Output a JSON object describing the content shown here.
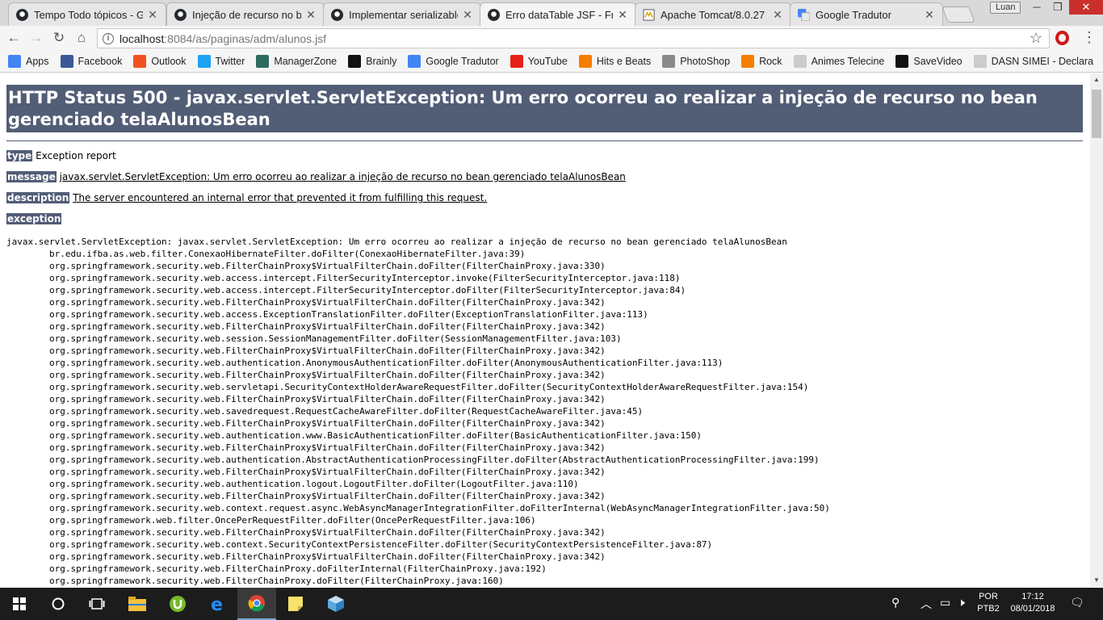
{
  "tabs": [
    {
      "title": "Tempo Todo tópicos - GU",
      "favicon": "github-icon",
      "active": false
    },
    {
      "title": "Injeção de recurso no be",
      "favicon": "github-icon",
      "active": false
    },
    {
      "title": "Implementar serializable",
      "favicon": "github-icon",
      "active": false
    },
    {
      "title": "Erro dataTable JSF - Fron",
      "favicon": "github-icon",
      "active": true
    },
    {
      "title": "Apache Tomcat/8.0.27 -",
      "favicon": "tomcat-icon",
      "active": false
    },
    {
      "title": "Google Tradutor",
      "favicon": "google-translate-icon",
      "active": false
    }
  ],
  "window": {
    "profile_name": "Luan"
  },
  "address": {
    "host": "localhost",
    "rest": ":8084/as/paginas/adm/alunos.jsf"
  },
  "bookmarks": [
    {
      "label": "Apps",
      "icon": "apps-grid-icon",
      "color": "#4285f4"
    },
    {
      "label": "Facebook",
      "icon": "facebook-icon",
      "color": "#3b5998"
    },
    {
      "label": "Outlook",
      "icon": "outlook-icon",
      "color": "#f25022"
    },
    {
      "label": "Twitter",
      "icon": "twitter-icon",
      "color": "#1da1f2"
    },
    {
      "label": "ManagerZone",
      "icon": "managerzone-icon",
      "color": "#2e6b5e"
    },
    {
      "label": "Brainly",
      "icon": "brainly-icon",
      "color": "#111111"
    },
    {
      "label": "Google Tradutor",
      "icon": "google-translate-icon",
      "color": "#4285f4"
    },
    {
      "label": "YouTube",
      "icon": "youtube-icon",
      "color": "#e62117"
    },
    {
      "label": "Hits e Beats",
      "icon": "blogger-icon",
      "color": "#f57d00"
    },
    {
      "label": "PhotoShop",
      "icon": "photoshop-icon",
      "color": "#8a8a8a"
    },
    {
      "label": "Rock",
      "icon": "blogger-icon",
      "color": "#f57d00"
    },
    {
      "label": "Animes Telecine",
      "icon": "page-icon",
      "color": "#cccccc"
    },
    {
      "label": "SaveVideo",
      "icon": "savevideo-icon",
      "color": "#111111"
    },
    {
      "label": "DASN SIMEI - Declara",
      "icon": "page-icon",
      "color": "#cccccc"
    }
  ],
  "error": {
    "title": "HTTP Status 500 - javax.servlet.ServletException: Um erro ocorreu ao realizar a injeção de recurso no bean gerenciado telaAlunosBean",
    "type_label": "type",
    "type_value": "Exception report",
    "message_label": "message",
    "message_value": "javax.servlet.ServletException: Um erro ocorreu ao realizar a injeção de recurso no bean gerenciado telaAlunosBean",
    "description_label": "description",
    "description_value": "The server encountered an internal error that prevented it from fulfilling this request.",
    "exception_label": "exception",
    "stack_trace": [
      "javax.servlet.ServletException: javax.servlet.ServletException: Um erro ocorreu ao realizar a injeção de recurso no bean gerenciado telaAlunosBean",
      "\tbr.edu.ifba.as.web.filter.ConexaoHibernateFilter.doFilter(ConexaoHibernateFilter.java:39)",
      "\torg.springframework.security.web.FilterChainProxy$VirtualFilterChain.doFilter(FilterChainProxy.java:330)",
      "\torg.springframework.security.web.access.intercept.FilterSecurityInterceptor.invoke(FilterSecurityInterceptor.java:118)",
      "\torg.springframework.security.web.access.intercept.FilterSecurityInterceptor.doFilter(FilterSecurityInterceptor.java:84)",
      "\torg.springframework.security.web.FilterChainProxy$VirtualFilterChain.doFilter(FilterChainProxy.java:342)",
      "\torg.springframework.security.web.access.ExceptionTranslationFilter.doFilter(ExceptionTranslationFilter.java:113)",
      "\torg.springframework.security.web.FilterChainProxy$VirtualFilterChain.doFilter(FilterChainProxy.java:342)",
      "\torg.springframework.security.web.session.SessionManagementFilter.doFilter(SessionManagementFilter.java:103)",
      "\torg.springframework.security.web.FilterChainProxy$VirtualFilterChain.doFilter(FilterChainProxy.java:342)",
      "\torg.springframework.security.web.authentication.AnonymousAuthenticationFilter.doFilter(AnonymousAuthenticationFilter.java:113)",
      "\torg.springframework.security.web.FilterChainProxy$VirtualFilterChain.doFilter(FilterChainProxy.java:342)",
      "\torg.springframework.security.web.servletapi.SecurityContextHolderAwareRequestFilter.doFilter(SecurityContextHolderAwareRequestFilter.java:154)",
      "\torg.springframework.security.web.FilterChainProxy$VirtualFilterChain.doFilter(FilterChainProxy.java:342)",
      "\torg.springframework.security.web.savedrequest.RequestCacheAwareFilter.doFilter(RequestCacheAwareFilter.java:45)",
      "\torg.springframework.security.web.FilterChainProxy$VirtualFilterChain.doFilter(FilterChainProxy.java:342)",
      "\torg.springframework.security.web.authentication.www.BasicAuthenticationFilter.doFilter(BasicAuthenticationFilter.java:150)",
      "\torg.springframework.security.web.FilterChainProxy$VirtualFilterChain.doFilter(FilterChainProxy.java:342)",
      "\torg.springframework.security.web.authentication.AbstractAuthenticationProcessingFilter.doFilter(AbstractAuthenticationProcessingFilter.java:199)",
      "\torg.springframework.security.web.FilterChainProxy$VirtualFilterChain.doFilter(FilterChainProxy.java:342)",
      "\torg.springframework.security.web.authentication.logout.LogoutFilter.doFilter(LogoutFilter.java:110)",
      "\torg.springframework.security.web.FilterChainProxy$VirtualFilterChain.doFilter(FilterChainProxy.java:342)",
      "\torg.springframework.security.web.context.request.async.WebAsyncManagerIntegrationFilter.doFilterInternal(WebAsyncManagerIntegrationFilter.java:50)",
      "\torg.springframework.web.filter.OncePerRequestFilter.doFilter(OncePerRequestFilter.java:106)",
      "\torg.springframework.security.web.FilterChainProxy$VirtualFilterChain.doFilter(FilterChainProxy.java:342)",
      "\torg.springframework.security.web.context.SecurityContextPersistenceFilter.doFilter(SecurityContextPersistenceFilter.java:87)",
      "\torg.springframework.security.web.FilterChainProxy$VirtualFilterChain.doFilter(FilterChainProxy.java:342)",
      "\torg.springframework.security.web.FilterChainProxy.doFilterInternal(FilterChainProxy.java:192)",
      "\torg.springframework.security.web.FilterChainProxy.doFilter(FilterChainProxy.java:160)"
    ]
  },
  "taskbar": {
    "apps": [
      {
        "name": "start-button",
        "icon": "windows-logo-icon"
      },
      {
        "name": "cortana-button",
        "icon": "circle-icon"
      },
      {
        "name": "task-view-button",
        "icon": "task-view-icon"
      },
      {
        "name": "file-explorer-button",
        "icon": "folder-icon"
      },
      {
        "name": "utorrent-button",
        "icon": "utorrent-icon"
      },
      {
        "name": "edge-button",
        "icon": "edge-icon"
      },
      {
        "name": "chrome-button",
        "icon": "chrome-icon"
      },
      {
        "name": "sticky-notes-button",
        "icon": "sticky-note-icon"
      },
      {
        "name": "box-app-button",
        "icon": "cube-icon"
      }
    ],
    "language_line1": "POR",
    "language_line2": "PTB2",
    "time": "17:12",
    "date": "08/01/2018"
  },
  "colors": {
    "error_header_bg": "#525d76",
    "tab_strip": "#d9d9d9",
    "taskbar": "#1c1c1c"
  }
}
